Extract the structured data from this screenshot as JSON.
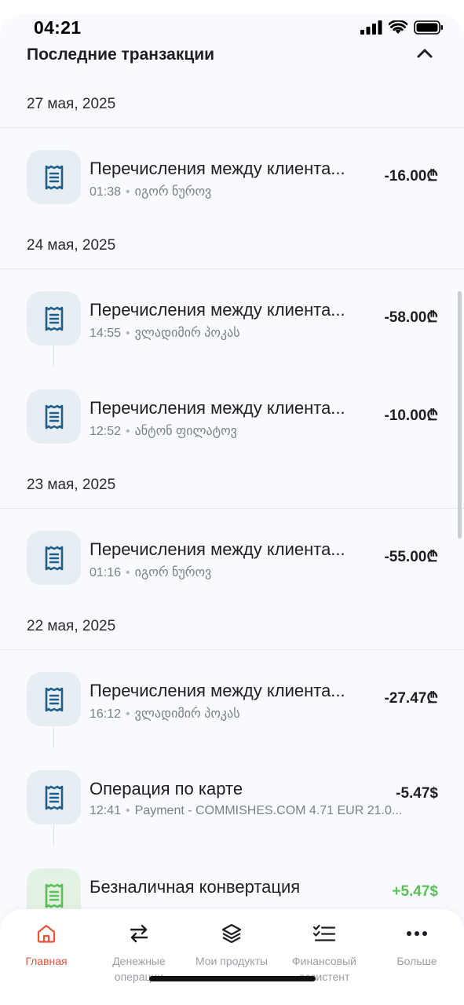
{
  "status_bar": {
    "time": "04:21"
  },
  "section": {
    "title": "Последние транзакции"
  },
  "groups": [
    {
      "date": "27 мая, 2025",
      "items": [
        {
          "title": "Перечисления между клиента...",
          "time": "01:38",
          "party": "იგორ ნუროვ",
          "amount": "-16.00₾",
          "kind": "receipt"
        }
      ]
    },
    {
      "date": "24 мая, 2025",
      "items": [
        {
          "title": "Перечисления между клиента...",
          "time": "14:55",
          "party": "ვლადიმირ პოკას",
          "amount": "-58.00₾",
          "kind": "receipt"
        },
        {
          "title": "Перечисления между клиента...",
          "time": "12:52",
          "party": "ანტონ ფილატოვ",
          "amount": "-10.00₾",
          "kind": "receipt"
        }
      ]
    },
    {
      "date": "23 мая, 2025",
      "items": [
        {
          "title": "Перечисления между клиента...",
          "time": "01:16",
          "party": "იგორ ნუროვ",
          "amount": "-55.00₾",
          "kind": "receipt"
        }
      ]
    },
    {
      "date": "22 мая, 2025",
      "items": [
        {
          "title": "Перечисления между клиента...",
          "time": "16:12",
          "party": "ვლადიმირ პოკას",
          "amount": "-27.47₾",
          "kind": "receipt"
        },
        {
          "title": "Операция по карте",
          "time": "12:41",
          "party": "Payment - COMMISHES.COM 4.71 EUR 21.0...",
          "amount": "-5.47$",
          "kind": "receipt"
        },
        {
          "title": "Безналичная конвертация",
          "time": "",
          "party": "",
          "amount": "+5.47$",
          "kind": "receipt-green"
        }
      ]
    }
  ],
  "nav": [
    {
      "label": "Главная",
      "icon": "home-icon",
      "active": true
    },
    {
      "label": "Денежные операции",
      "icon": "transfer-arrows-icon",
      "active": false
    },
    {
      "label": "Мои продукты",
      "icon": "layers-icon",
      "active": false
    },
    {
      "label": "Финансовый ассистент",
      "icon": "checklist-icon",
      "active": false
    },
    {
      "label": "Больше",
      "icon": "more-dots-icon",
      "active": false
    }
  ],
  "colors": {
    "accent": "#e8533a",
    "icon_blue": "#1f5f8a",
    "positive": "#5bbf5a"
  }
}
